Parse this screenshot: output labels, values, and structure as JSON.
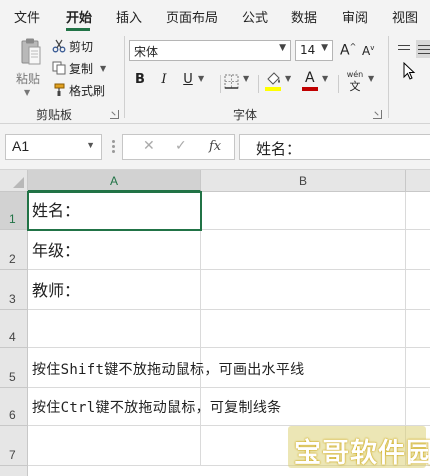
{
  "menu": {
    "tabs": [
      {
        "label": "文件"
      },
      {
        "label": "开始"
      },
      {
        "label": "插入"
      },
      {
        "label": "页面布局"
      },
      {
        "label": "公式"
      },
      {
        "label": "数据"
      },
      {
        "label": "审阅"
      },
      {
        "label": "视图"
      }
    ],
    "active_tab": "开始"
  },
  "ribbon": {
    "clipboard": {
      "paste_label": "粘贴",
      "cut_label": "剪切",
      "copy_label": "复制",
      "format_painter_label": "格式刷",
      "group_label": "剪贴板"
    },
    "font": {
      "font_name": "宋体",
      "font_size": "14",
      "increase_size": "A",
      "decrease_size": "A",
      "bold": "B",
      "italic": "I",
      "underline": "U",
      "font_color_letter": "A",
      "phonetic": "wén",
      "phonetic_char": "文",
      "group_label": "字体",
      "highlight_color": "#ffff00",
      "font_color": "#c00000"
    }
  },
  "formula_bar": {
    "name_box": "A1",
    "fx_label": "fx",
    "content": "姓名："
  },
  "sheet": {
    "columns": [
      {
        "label": "A"
      },
      {
        "label": "B"
      }
    ],
    "rows": [
      {
        "num": "1",
        "a": "姓名："
      },
      {
        "num": "2",
        "a": "年级："
      },
      {
        "num": "3",
        "a": "教师："
      },
      {
        "num": "4",
        "a": ""
      },
      {
        "num": "5",
        "a": "按住Shift键不放拖动鼠标，可画出水平线"
      },
      {
        "num": "6",
        "a": "按住Ctrl键不放拖动鼠标，可复制线条"
      },
      {
        "num": "7",
        "a": ""
      }
    ]
  },
  "watermark": {
    "text": "宝哥软件园"
  },
  "colors": {
    "accent": "#217346",
    "ribbon_bg": "#f3f3f3",
    "header_bg": "#e6e6e6"
  }
}
